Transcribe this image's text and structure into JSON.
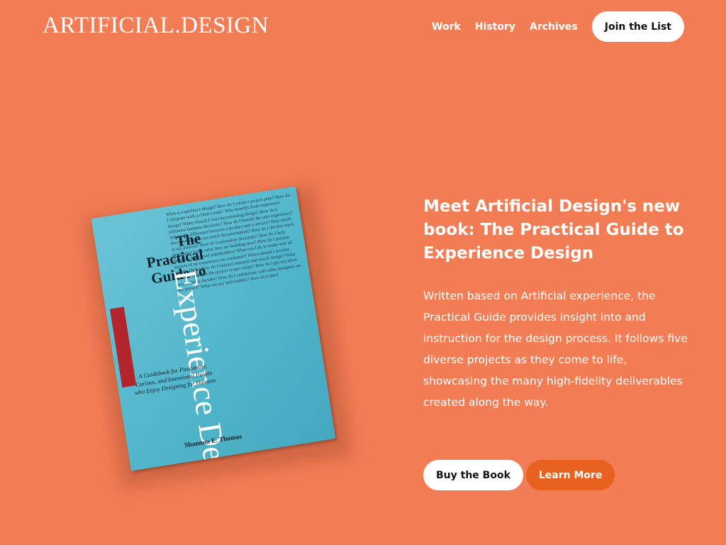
{
  "header": {
    "logo": "ARTIFICIAL.DESIGN",
    "nav": [
      "Work",
      "History",
      "Archives"
    ],
    "cta": "Join the List"
  },
  "book": {
    "title": "The Practical Guide to",
    "title_large": "Experience Design",
    "subtitle": "A Guidebook for Passionate, Curious, and Intentional People who Enjoy Designing for Humans",
    "author": "Shannon E. Thomas",
    "cover_text": "What is experience design? How do I create a project plan? How do I integrate with a client's team? Who benefits from experience design? When should I start documenting design? How do I influence business decisions? How do I benefit the user experience? What's the difference between a product and a service? How much documentation is too much documentation? How do I involve users in my process? How do I rationalize decisions? How do I help developers know what they are building next? How do I present design to high-level stakeholders? What can I do to make sure all aspects of an experience are consistent? When should I involve stakeholders? How do I balance research and visual design? What should I do when the project scope creeps? How do I get my ideas across? Who decides? How do I collaborate with other designers on my project? What are my deliverables? How do I start?"
  },
  "hero": {
    "headline": "Meet Artificial Design's new book: The Practical Guide to Experience Design",
    "description": "Written based on Artificial experience, the Practical Guide provides insight into and instruction for the design process. It follows five diverse projects as they come to life, showcasing the many high-fidelity deliverables created along the way.",
    "buy_label": "Buy the Book",
    "learn_label": "Learn More"
  },
  "colors": {
    "background": "#f27d55",
    "accent_button": "#e8611e",
    "book_cover": "#52b6cb",
    "book_spine": "#b2252c"
  }
}
